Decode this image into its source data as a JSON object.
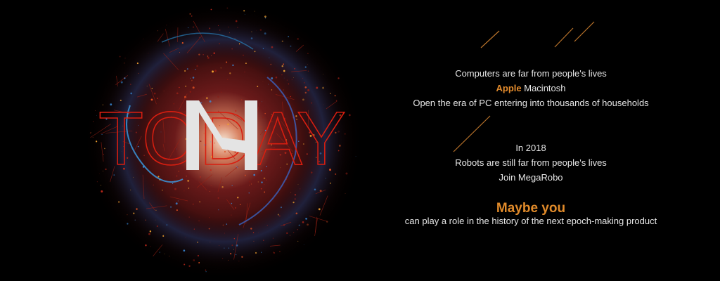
{
  "hero": {
    "word": "TODAY",
    "logo": "M",
    "colors": {
      "word": "#d81e10",
      "logo": "#e6e6e6",
      "accent": "#e08a2a",
      "sphere_red": "#c0281a",
      "sphere_blue": "#2a7fd0"
    }
  },
  "story": {
    "line1": "Computers are far from people's lives",
    "apple": "Apple",
    "macintosh": "Macintosh",
    "line3": "Open the era of PC entering into thousands of households",
    "year": "In 2018",
    "line5": "Robots are still far from people's lives",
    "line6": "Join MegaRobo",
    "headline": "Maybe you",
    "tagline": "can play a role in the history of the next epoch-making product"
  }
}
